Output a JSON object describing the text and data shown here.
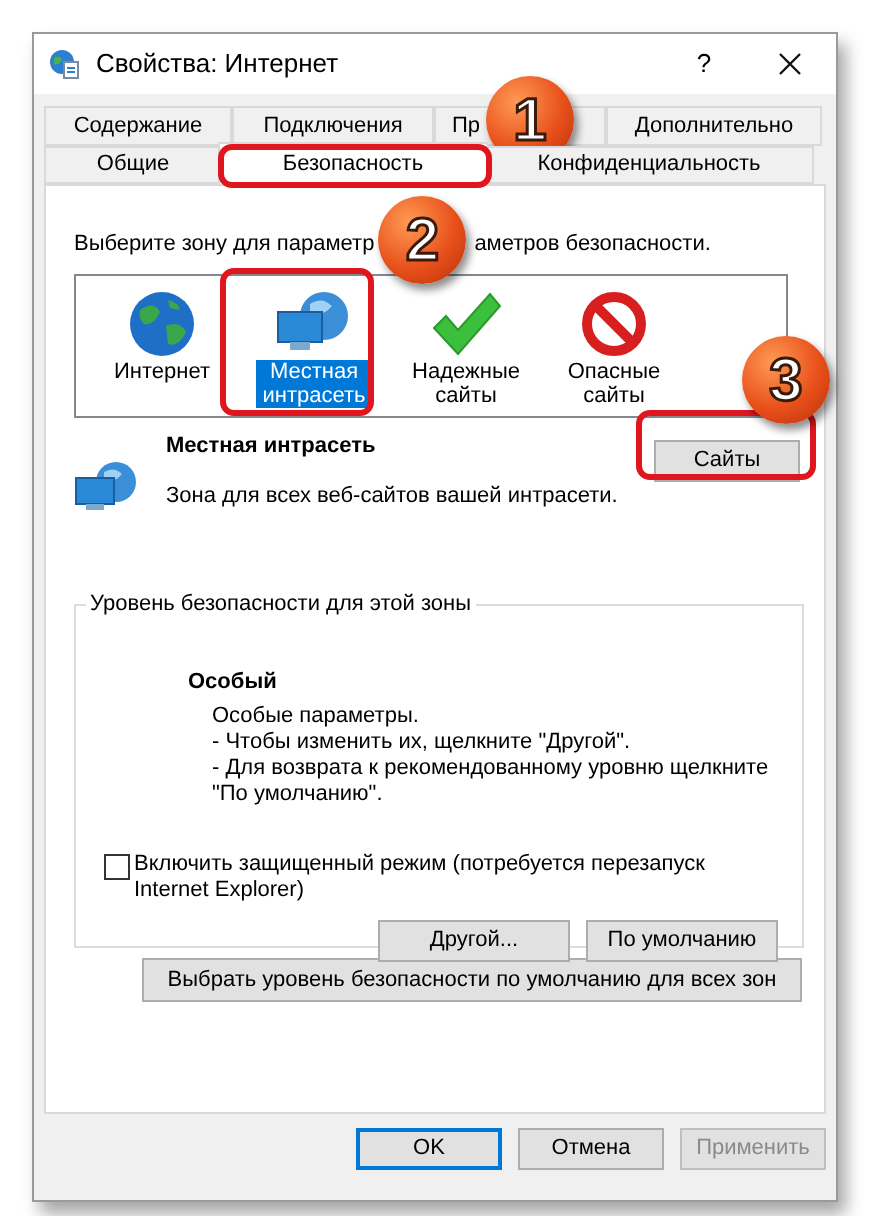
{
  "window": {
    "title": "Свойства: Интернет",
    "help": "?"
  },
  "tab_rows": [
    [
      {
        "label": "Содержание",
        "selected": false
      },
      {
        "label": "Подключения",
        "selected": false
      },
      {
        "label": "Пр",
        "selected": false
      },
      {
        "label": "Дополнительно",
        "selected": false
      }
    ],
    [
      {
        "label": "Общие",
        "selected": false
      },
      {
        "label": "Безопасность",
        "selected": true
      },
      {
        "label": "Конфиденциальность",
        "selected": false
      }
    ]
  ],
  "prompt_parts": [
    "Выберите зону для параметр",
    "аметров безопасности."
  ],
  "zones": [
    {
      "kind": "globe",
      "label": "Интернет",
      "selected": false
    },
    {
      "kind": "intranet",
      "label": "Местная интрасеть",
      "selected": true
    },
    {
      "kind": "check",
      "label": "Надежные сайты",
      "selected": false
    },
    {
      "kind": "forbidden",
      "label": "Опасные сайты",
      "selected": false
    }
  ],
  "zone_info": {
    "title": "Местная интрасеть",
    "description": "Зона для всех веб-сайтов вашей интрасети.",
    "button": "Сайты"
  },
  "security_level": {
    "legend": "Уровень безопасности для этой зоны",
    "level_name": "Особый",
    "lines": [
      "Особые параметры.",
      "- Чтобы изменить их, щелкните \"Другой\".",
      "- Для возврата к рекомендованному уровню щелкните \"По умолчанию\"."
    ],
    "protected_mode": {
      "label": "Включить защищенный режим (потребуется перезапуск Internet Explorer)",
      "checked": false
    },
    "buttons": [
      "Другой...",
      "По умолчанию"
    ]
  },
  "reset_all_button": "Выбрать уровень безопасности по умолчанию для всех зон",
  "footer_buttons": [
    {
      "label": "OK",
      "kind": "default",
      "disabled": false
    },
    {
      "label": "Отмена",
      "kind": "normal",
      "disabled": false
    },
    {
      "label": "Применить",
      "kind": "normal",
      "disabled": true
    }
  ],
  "callouts": [
    {
      "number": "1"
    },
    {
      "number": "2"
    },
    {
      "number": "3"
    }
  ]
}
